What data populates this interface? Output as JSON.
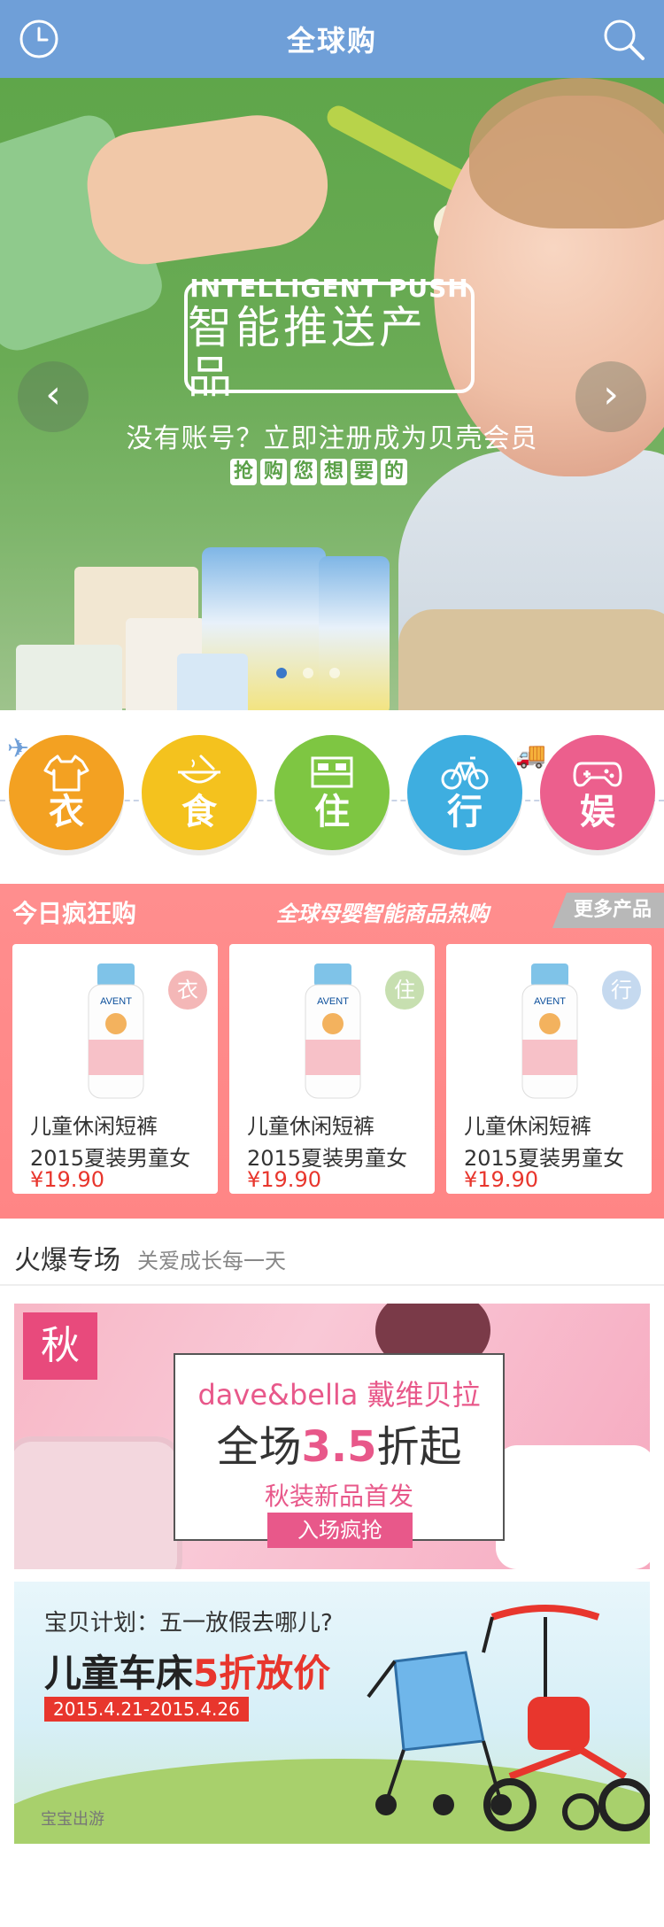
{
  "header": {
    "title": "全球购",
    "left_icon": "clock-icon",
    "right_icon": "search-icon"
  },
  "hero": {
    "logo_en": "INTELLIGENT PUSH",
    "logo_cn": "智能推送产品",
    "promo": "没有账号？立即注册成为贝壳会员",
    "grab": [
      "抢",
      "购",
      "您",
      "想",
      "要",
      "的"
    ],
    "prev": "‹",
    "next": "›"
  },
  "categories": [
    {
      "label": "衣",
      "icon": "clothes-icon",
      "color": "#f3a122"
    },
    {
      "label": "食",
      "icon": "bowl-icon",
      "color": "#f4c21e"
    },
    {
      "label": "住",
      "icon": "bed-icon",
      "color": "#7ec642"
    },
    {
      "label": "行",
      "icon": "bicycle-icon",
      "color": "#3eaee0"
    },
    {
      "label": "娱",
      "icon": "gamepad-icon",
      "color": "#ec5f8d"
    }
  ],
  "crazy": {
    "title": "今日疯狂购",
    "subtitle": "全球母婴智能商品热购",
    "more": "更多产品",
    "items": [
      {
        "badge": "衣",
        "badge_color": "#f4b7b7",
        "name": "儿童休闲短裤",
        "desc": "2015夏装男童女",
        "price": "¥19.90"
      },
      {
        "badge": "住",
        "badge_color": "#c7dfb0",
        "name": "儿童休闲短裤",
        "desc": "2015夏装男童女",
        "price": "¥19.90"
      },
      {
        "badge": "行",
        "badge_color": "#c5d9ef",
        "name": "儿童休闲短裤",
        "desc": "2015夏装男童女",
        "price": "¥19.90"
      }
    ]
  },
  "hot": {
    "title": "火爆专场",
    "subtitle": "关爱成长每一天"
  },
  "banner1": {
    "tag": "秋",
    "brand": "dave&bella 戴维贝拉",
    "big_pre": "全场",
    "big_num": "3.5",
    "big_post": "折起",
    "sub": "秋装新品首发",
    "button": "入场疯抢"
  },
  "banner2": {
    "question": "宝贝计划：五一放假去哪儿?",
    "big_pre": "儿童车床",
    "big_red": "5折放价",
    "date": "2015.4.21-2015.4.26",
    "footer": "宝宝出游"
  }
}
